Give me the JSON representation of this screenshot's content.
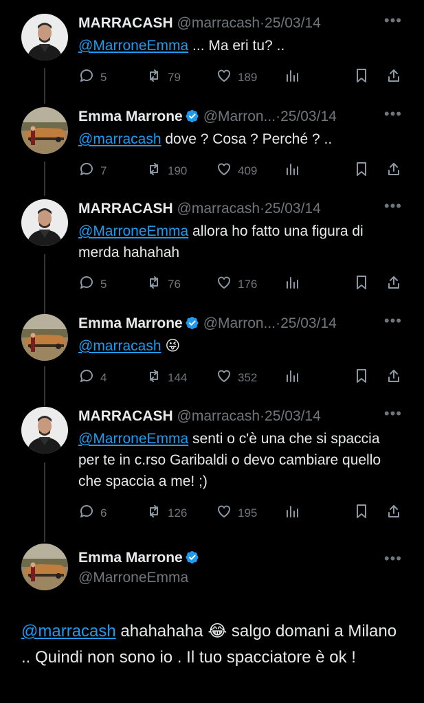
{
  "colors": {
    "background": "#000000",
    "text": "#e7e9ea",
    "muted": "#71767b",
    "link": "#1d9bf0",
    "verified": "#1d9bf0"
  },
  "more_icon": "•••",
  "tweets": [
    {
      "name": "MARRACASH",
      "handle": "@marracash",
      "dot": "·",
      "date": "25/03/14",
      "mention": "@MarroneEmma",
      "body": " ... Ma eri tu? ..",
      "verified": false,
      "replies": "5",
      "retweets": "79",
      "likes": "189"
    },
    {
      "name": "Emma Marrone",
      "handle": "@Marron...",
      "dot": "·",
      "date": "25/03/14",
      "mention": "@marracash",
      "body": " dove ? Cosa ? Perché ? ..",
      "verified": true,
      "replies": "7",
      "retweets": "190",
      "likes": "409"
    },
    {
      "name": "MARRACASH",
      "handle": "@marracash",
      "dot": "·",
      "date": "25/03/14",
      "mention": "@MarroneEmma",
      "body": " allora ho fatto una figura di merda hahahah",
      "verified": false,
      "replies": "5",
      "retweets": "76",
      "likes": "176"
    },
    {
      "name": "Emma Marrone",
      "handle": "@Marron...",
      "dot": "·",
      "date": "25/03/14",
      "mention": "@marracash",
      "body": " 😜",
      "verified": true,
      "replies": "4",
      "retweets": "144",
      "likes": "352"
    },
    {
      "name": "MARRACASH",
      "handle": "@marracash",
      "dot": "·",
      "date": "25/03/14",
      "mention": "@MarroneEmma",
      "body": " senti o c'è una che si spaccia per te in c.rso Garibaldi o devo cambiare quello che spaccia a me! ;)",
      "verified": false,
      "replies": "6",
      "retweets": "126",
      "likes": "195"
    }
  ],
  "main_tweet": {
    "name": "Emma Marrone",
    "handle": "@MarroneEmma",
    "mention": "@marracash",
    "body": " ahahahaha 😂 salgo domani a Milano .. Quindi non sono io . Il tuo spacciatore è ok !"
  }
}
